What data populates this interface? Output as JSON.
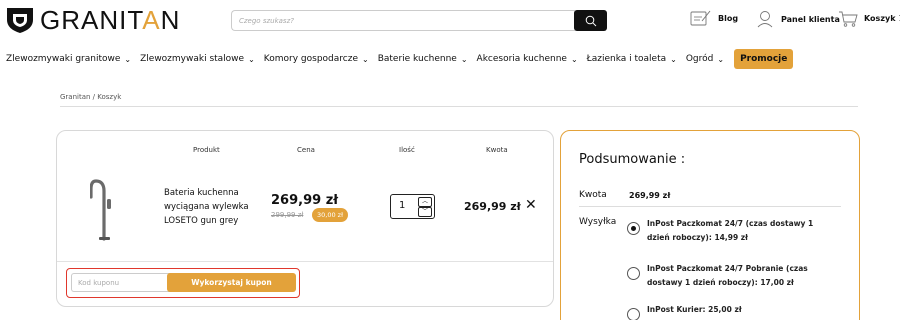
{
  "header": {
    "logo_text_1": "GRANIT",
    "logo_text_a": "A",
    "logo_text_2": "N",
    "search_placeholder": "Czego szukasz?",
    "blog_label": "Blog",
    "panel_label": "Panel klienta",
    "cart_label": "Koszyk",
    "cart_count": "1"
  },
  "nav": {
    "items": [
      "Zlewozmywaki granitowe",
      "Zlewozmywaki stalowe",
      "Komory gospodarcze",
      "Baterie kuchenne",
      "Akcesoria kuchenne",
      "Łazienka i toaleta",
      "Ogród"
    ],
    "promo_label": "Promocje"
  },
  "breadcrumb": "Granitan / Koszyk",
  "cart": {
    "columns": {
      "product": "Produkt",
      "price": "Cena",
      "qty": "Ilość",
      "total": "Kwota"
    },
    "item": {
      "name": "Bateria kuchenna wyciągana wylewka LOSETO gun grey",
      "price": "269,99 zł",
      "old_price": "299,99 zł",
      "discount": "30,00 zł",
      "quantity": "1",
      "line_total": "269,99 zł",
      "remove_icon": "✕"
    },
    "coupon": {
      "placeholder": "Kod kuponu",
      "button_label": "Wykorzystaj kupon"
    }
  },
  "summary": {
    "title": "Podsumowanie :",
    "amount_label": "Kwota",
    "amount_value": "269,99 zł",
    "shipping_label": "Wysyłka",
    "options": [
      {
        "label": "InPost Paczkomat 24/7 (czas dostawy 1 dzień roboczy): 14,99 zł",
        "selected": true
      },
      {
        "label": "InPost Paczkomat 24/7 Pobranie (czas dostawy 1 dzień roboczy): 17,00 zł",
        "selected": false
      },
      {
        "label": "InPost Kurier: 25,00 zł",
        "selected": false
      }
    ]
  },
  "colors": {
    "accent": "#e3a23a",
    "highlight_border": "#e0372c"
  }
}
